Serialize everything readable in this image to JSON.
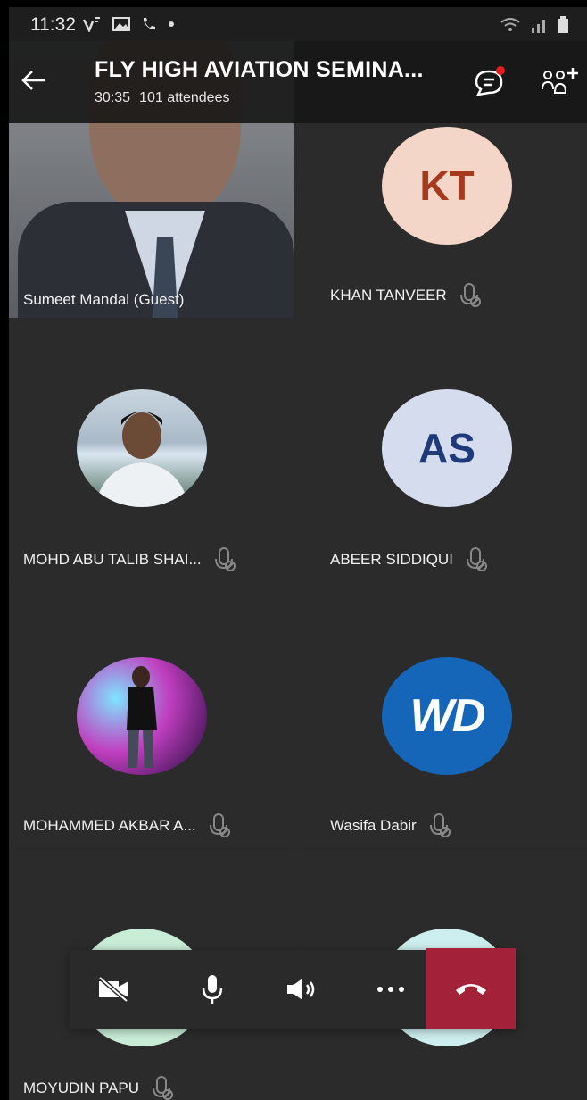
{
  "status_bar": {
    "time": "11:32"
  },
  "meeting": {
    "title": "FLY HIGH AVIATION SEMINA...",
    "duration": "30:35",
    "attendees": "101 attendees"
  },
  "participants": [
    {
      "name": "Sumeet Mandal (Guest)",
      "type": "video"
    },
    {
      "name": "KHAN TANVEER",
      "initials": "KT",
      "avatar_bg": "#f3d6c8",
      "avatar_fg": "#a63a1e",
      "muted": true
    },
    {
      "name": "MOHD ABU TALIB SHAI...",
      "type": "photo",
      "muted": true
    },
    {
      "name": "ABEER SIDDIQUI",
      "initials": "AS",
      "avatar_bg": "#d4dcee",
      "avatar_fg": "#1e3a78",
      "muted": true
    },
    {
      "name": "MOHAMMED AKBAR A...",
      "type": "photo",
      "muted": true
    },
    {
      "name": "Wasifa Dabir",
      "avatar_logo": "WD",
      "avatar_bg": "#1566b8",
      "muted": true
    },
    {
      "name": "MOYUDIN PAPU",
      "avatar_bg": "#c8ecd6",
      "muted": true
    },
    {
      "name": "",
      "avatar_bg": "#cdeeee"
    }
  ],
  "controls": {
    "camera": "video-off-icon",
    "mic": "microphone-icon",
    "speaker": "speaker-icon",
    "more": "more-options-icon",
    "hangup": "hang-up-icon",
    "hangup_color": "#a3223a"
  }
}
